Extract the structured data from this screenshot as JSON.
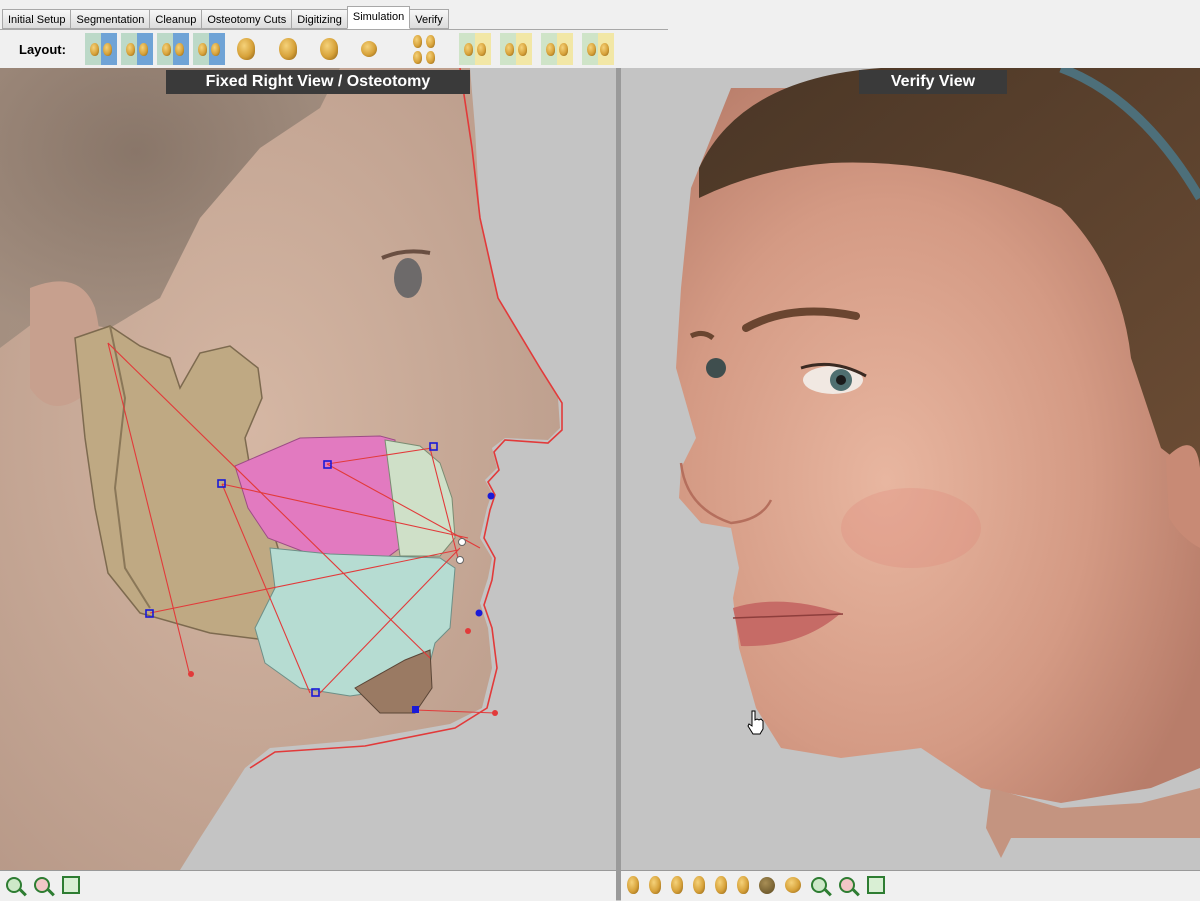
{
  "tabs": [
    "Initial Setup",
    "Segmentation",
    "Cleanup",
    "Osteotomy Cuts",
    "Digitizing",
    "Simulation",
    "Verify"
  ],
  "active_tab": "Simulation",
  "layout": {
    "label": "Layout:"
  },
  "left_view": {
    "title": "Fixed Right View / Osteotomy"
  },
  "right_view": {
    "title": "Verify View"
  },
  "colors": {
    "bone": "#bfa983",
    "maxilla": "#e27ac0",
    "teeth": "#cfe0c8",
    "mandible": "#b6dcd2",
    "landmark": "#1a1ad8",
    "cutline": "#e23a3a",
    "skin": "#d7ad98"
  }
}
